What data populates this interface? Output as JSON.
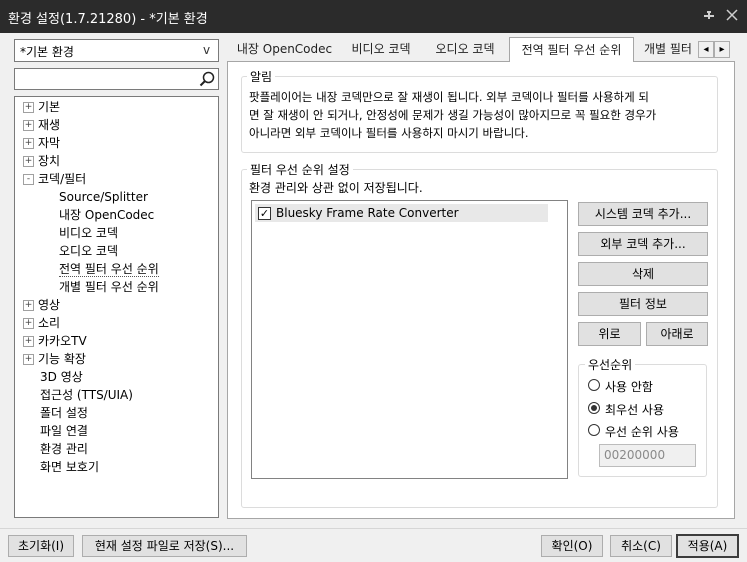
{
  "window": {
    "title": "환경 설정(1.7.21280) - *기본 환경",
    "pin_icon": "pin-icon",
    "close_icon": "close-icon"
  },
  "preset": {
    "selected": "*기본 환경",
    "chevron": "v"
  },
  "search": {
    "value": "",
    "placeholder": ""
  },
  "tree": {
    "items": [
      {
        "label": "기본",
        "expander": "+"
      },
      {
        "label": "재생",
        "expander": "+"
      },
      {
        "label": "자막",
        "expander": "+"
      },
      {
        "label": "장치",
        "expander": "+"
      },
      {
        "label": "코덱/필터",
        "expander": "-"
      },
      {
        "label": "Source/Splitter"
      },
      {
        "label": "내장 OpenCodec"
      },
      {
        "label": "비디오 코덱"
      },
      {
        "label": "오디오 코덱"
      },
      {
        "label": "전역 필터 우선 순위",
        "selected": true
      },
      {
        "label": "개별 필터 우선 순위"
      },
      {
        "label": "영상",
        "expander": "+"
      },
      {
        "label": "소리",
        "expander": "+"
      },
      {
        "label": "카카오TV",
        "expander": "+"
      },
      {
        "label": "기능 확장",
        "expander": "+"
      },
      {
        "label": "3D 영상"
      },
      {
        "label": "접근성 (TTS/UIA)"
      },
      {
        "label": "폴더 설정"
      },
      {
        "label": "파일 연결"
      },
      {
        "label": "환경 관리"
      },
      {
        "label": "화면 보호기"
      }
    ]
  },
  "tabs": [
    {
      "label": "내장 OpenCodec"
    },
    {
      "label": "비디오 코덱"
    },
    {
      "label": "오디오 코덱"
    },
    {
      "label": "전역 필터 우선 순위",
      "active": true
    },
    {
      "label": "개별 필터"
    }
  ],
  "tab_scroll": {
    "left": "◂",
    "right": "▸"
  },
  "notice": {
    "legend": "알림",
    "line1": "팟플레이어는 내장 코덱만으로 잘 재생이 됩니다. 외부 코덱이나 필터를 사용하게 되",
    "line2": "면 잘 재생이 안 되거나, 안정성에 문제가 생길 가능성이 많아지므로 꼭 필요한 경우가",
    "line3": "아니라면 외부 코덱이나 필터를 사용하지 마시기 바랍니다."
  },
  "priority": {
    "legend": "필터 우선 순위 설정",
    "desc": "환경 관리와 상관 없이 저장됩니다.",
    "filters": [
      {
        "label": "Bluesky Frame Rate Converter",
        "checked": true,
        "check_mark": "✓"
      }
    ],
    "buttons": {
      "add_system": "시스템 코덱 추가...",
      "add_external": "외부 코덱 추가...",
      "delete": "삭제",
      "filter_info": "필터 정보",
      "up": "위로",
      "down": "아래로"
    },
    "rank": {
      "legend": "우선순위",
      "options": [
        {
          "label": "사용 안함",
          "selected": false
        },
        {
          "label": "최우선 사용",
          "selected": true
        },
        {
          "label": "우선 순위 사용",
          "selected": false
        }
      ],
      "value": "00200000"
    }
  },
  "footer": {
    "reset": "초기화(I)",
    "save_file": "현재 설정 파일로 저장(S)...",
    "ok": "확인(O)",
    "cancel": "취소(C)",
    "apply": "적용(A)"
  },
  "icons": {
    "search": "search-icon"
  }
}
